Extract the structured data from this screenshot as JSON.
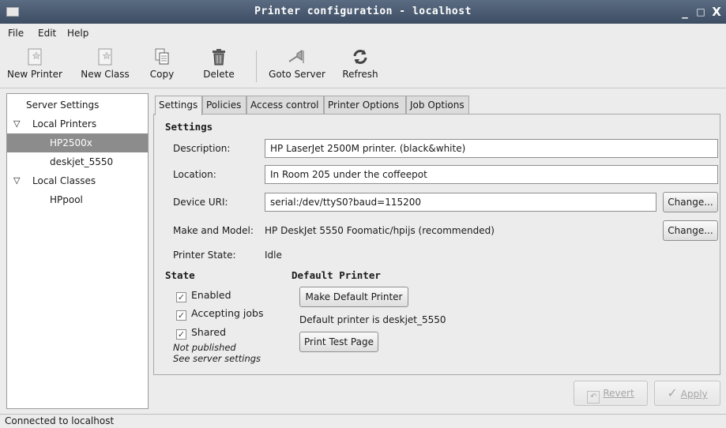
{
  "window": {
    "title": "Printer configuration - localhost",
    "controls": [
      "_",
      "□",
      "X"
    ]
  },
  "menu": [
    {
      "label": "File",
      "mnemonic": "F"
    },
    {
      "label": "Edit",
      "mnemonic": "E"
    },
    {
      "label": "Help",
      "mnemonic": "H"
    }
  ],
  "toolbar": {
    "new_printer": "New Printer",
    "new_class": "New Class",
    "copy": "Copy",
    "delete": "Delete",
    "goto_server": "Goto Server",
    "refresh": "Refresh"
  },
  "sidebar": {
    "server_settings": "Server Settings",
    "local_printers": "Local Printers",
    "printers": [
      "HP2500x",
      "deskjet_5550"
    ],
    "selected": "HP2500x",
    "local_classes": "Local Classes",
    "classes": [
      "HPpool"
    ]
  },
  "tabs": [
    "Settings",
    "Policies",
    "Access control",
    "Printer Options",
    "Job Options"
  ],
  "active_tab": "Settings",
  "settings": {
    "heading": "Settings",
    "description_label": "Description:",
    "description_value": "HP LaserJet 2500M printer. (black&white)",
    "location_label": "Location:",
    "location_value": "In Room 205 under the coffeepot",
    "device_uri_label": "Device URI:",
    "device_uri_value": "serial:/dev/ttyS0?baud=115200",
    "change_label": "Change...",
    "make_model_label": "Make and Model:",
    "make_model_value": "HP DeskJet 5550 Foomatic/hpijs (recommended)",
    "printer_state_label": "Printer State:",
    "printer_state_value": "Idle"
  },
  "state": {
    "heading": "State",
    "enabled": "Enabled",
    "accepting_jobs": "Accepting jobs",
    "shared": "Shared",
    "checked": [
      true,
      true,
      true
    ],
    "note_line1": "Not published",
    "note_line2": "See server settings"
  },
  "default_printer": {
    "heading": "Default Printer",
    "make_default": "Make Default Printer",
    "status_text": "Default printer is deskjet_5550",
    "print_test": "Print Test Page"
  },
  "footer_buttons": {
    "revert": "Revert",
    "apply": "Apply"
  },
  "statusbar": {
    "text": "Connected to localhost"
  }
}
